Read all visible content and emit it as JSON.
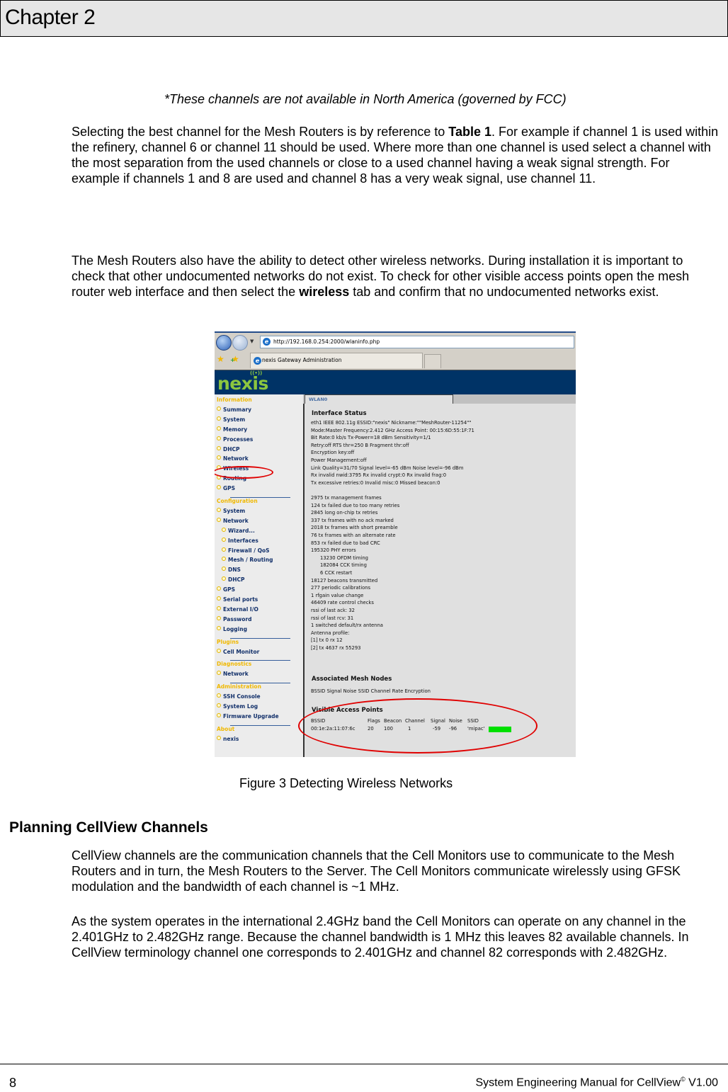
{
  "header": {
    "chapter": "Chapter 2"
  },
  "footnote": "*These channels are not available in North America (governed by FCC)",
  "paragraphs": {
    "p1_before": "Selecting the best channel for the Mesh Routers is by reference to ",
    "p1_bold": "Table 1",
    "p1_after": ". For example if channel 1 is used within the refinery, channel 6 or channel 11 should be used. Where more than one channel is used select a channel with the most separation from the used channels or close to a used channel having a weak signal strength. For example if channels 1 and 8 are used and channel 8 has a very weak signal, use channel 11.",
    "p2_before": "The Mesh Routers also have the ability to detect other wireless networks. During installation it is important to check that other undocumented networks do not exist.  To check for other visible access points open the mesh router web interface and then select the ",
    "p2_bold": "wireless",
    "p2_after": " tab and confirm that no undocumented networks exist.",
    "p3": "CellView channels are the communication channels that the Cell Monitors use to communicate to the Mesh Routers and in turn, the Mesh Routers to the Server. The Cell Monitors communicate wirelessly using GFSK modulation and the bandwidth of each channel is ~1 MHz.",
    "p4": "As the system operates in the international 2.4GHz band the Cell Monitors can operate on any channel in the 2.401GHz to 2.482GHz range. Because the channel bandwidth is 1 MHz this leaves 82 available channels. In CellView terminology channel one corresponds to 2.401GHz and channel 82 corresponds with 2.482GHz."
  },
  "figure": {
    "caption": "Figure 3  Detecting Wireless Networks",
    "browser": {
      "address": "http://192.168.0.254:2000/wlaninfo.php",
      "tab_title": "nexis Gateway Administration",
      "ie_glyph": "e",
      "nav_dropdown": "▼",
      "favorites_icon": "★",
      "add_favorites_icon": "★",
      "add_plus": "+"
    },
    "logo": {
      "text": "nexis",
      "signal_glyph": "((•))"
    },
    "sidebar": {
      "information": "Information",
      "info_items": [
        "Summary",
        "System",
        "Memory",
        "Processes",
        "DHCP",
        "Network",
        "Wireless",
        "Routing",
        "GPS"
      ],
      "configuration": "Configuration",
      "config_items": [
        "System",
        "Network"
      ],
      "network_subitems": [
        "Wizard...",
        "Interfaces",
        "Firewall / QoS",
        "Mesh / Routing",
        "DNS",
        "DHCP"
      ],
      "config_items2": [
        "GPS",
        "Serial ports",
        "External I/O",
        "Password",
        "Logging"
      ],
      "plugins": "Plugins",
      "plugin_items": [
        "Cell Monitor"
      ],
      "diagnostics": "Diagnostics",
      "diag_items": [
        "Network"
      ],
      "administration": "Administration",
      "admin_items": [
        "SSH Console",
        "System Log",
        "Firmware Upgrade"
      ],
      "about": "About",
      "about_items": [
        "nexis"
      ],
      "highlighted_item": "Wireless"
    },
    "panel": {
      "tab": "WLAN0",
      "interface_status_title": "Interface Status",
      "interface_status": [
        "eth1 IEEE 802.11g ESSID:\"nexis\" Nickname:\"\"MeshRouter-11254\"\"",
        "Mode:Master Frequency:2.412 GHz Access Point: 00:15:6D:55:1F:71",
        "Bit Rate:0 kb/s Tx-Power=18 dBm Sensitivity=1/1",
        "Retry:off RTS thr=250 B Fragment thr:off",
        "Encryption key:off",
        "Power Management:off",
        "Link Quality=31/70 Signal level=-65 dBm Noise level=-96 dBm",
        "Rx invalid nwid:3795 Rx invalid crypt:0 Rx invalid frag:0",
        "Tx excessive retries:0 Invalid misc:0 Missed beacon:0"
      ],
      "stats": [
        "2975 tx management frames",
        "124 tx failed due to too many retries",
        "2845 long on-chip tx retries",
        "337 tx frames with no ack marked",
        "2018 tx frames with short preamble",
        "76 tx frames with an alternate rate",
        "853 rx failed due to bad CRC",
        "195320 PHY errors"
      ],
      "phy_sub": [
        "13230 OFDM timing",
        "182084 CCK timing",
        "6 CCK restart"
      ],
      "stats2": [
        "18127 beacons transmitted",
        "277 periodic calibrations",
        "1 rfgain value change",
        "46409 rate control checks",
        "rssi of last ack: 32",
        "rssi of last rcv: 31",
        "1 switched default/rx antenna",
        "Antenna profile:",
        "[1] tx 0 rx 12",
        "[2] tx 4637 rx 55293"
      ],
      "mesh_nodes_title": "Associated Mesh Nodes",
      "mesh_nodes_header": "BSSID Signal Noise SSID Channel Rate Encryption",
      "visible_ap_title": "Visible Access Points",
      "ap_columns": [
        "BSSID",
        "Flags",
        "Beacon",
        "Channel",
        "Signal",
        "Noise",
        "SSID"
      ],
      "ap_rows": [
        {
          "bssid": "00:1e:2a:11:07:6c",
          "flags": "20",
          "beacon": "100",
          "channel": "1",
          "signal": "-59",
          "noise": "-96",
          "ssid": "'mipac'",
          "signal_color": "#00e000"
        }
      ]
    },
    "annotation_color": "#e00000"
  },
  "section": {
    "heading": "Planning CellView Channels"
  },
  "footer": {
    "page_number": "8",
    "title": "System Engineering Manual for CellView",
    "copyright_mark": "©",
    "version": " V1.00"
  }
}
